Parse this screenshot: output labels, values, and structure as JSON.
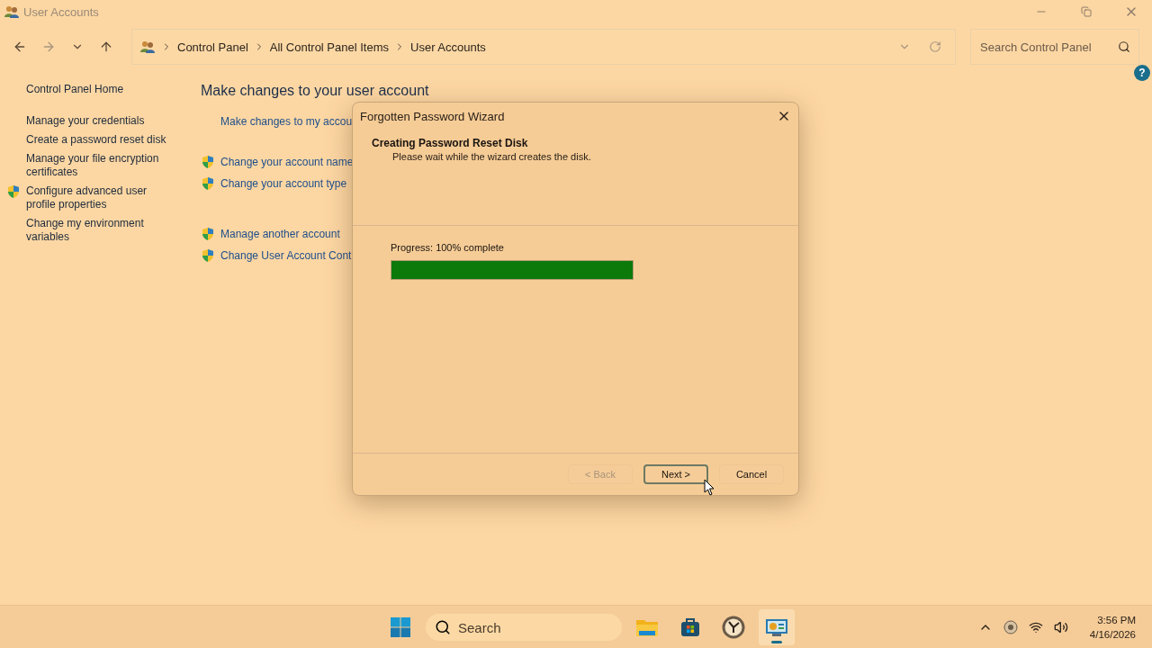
{
  "window": {
    "title": "User Accounts"
  },
  "address": {
    "crumbs": [
      "Control Panel",
      "All Control Panel Items",
      "User Accounts"
    ]
  },
  "search": {
    "placeholder": "Search Control Panel"
  },
  "help": "?",
  "sidebar": {
    "home": "Control Panel Home",
    "items": [
      {
        "label": "Manage your credentials",
        "shield": false
      },
      {
        "label": "Create a password reset disk",
        "shield": false
      },
      {
        "label": "Manage your file encryption certificates",
        "shield": false
      },
      {
        "label": "Configure advanced user profile properties",
        "shield": true
      },
      {
        "label": "Change my environment variables",
        "shield": false
      }
    ]
  },
  "main": {
    "heading": "Make changes to your user account",
    "groups": [
      [
        {
          "label": "Make changes to my accou",
          "shield": false
        }
      ],
      [
        {
          "label": "Change your account name",
          "shield": true
        },
        {
          "label": "Change your account type",
          "shield": true
        }
      ],
      [
        {
          "label": "Manage another account",
          "shield": true
        },
        {
          "label": "Change User Account Cont",
          "shield": true
        }
      ]
    ]
  },
  "dialog": {
    "title": "Forgotten Password Wizard",
    "heading": "Creating Password Reset Disk",
    "subheading": "Please wait while the wizard creates the disk.",
    "progress_label": "Progress: 100% complete",
    "level": 1,
    "buttons": [
      {
        "label": "< Back",
        "disabled": true,
        "selected": false
      },
      {
        "label": "Next >",
        "disabled": false,
        "selected": true
      },
      {
        "label": "Cancel",
        "disabled": false,
        "selected": false
      }
    ]
  },
  "taskbar": {
    "search_placeholder": "Search",
    "apps": [
      {
        "kind": "folder",
        "selected": false
      },
      {
        "kind": "store",
        "selected": false
      },
      {
        "kind": "clock",
        "selected": false
      },
      {
        "kind": "control",
        "selected": true
      }
    ],
    "time": "3:56 PM",
    "date": "4/16/2026"
  }
}
